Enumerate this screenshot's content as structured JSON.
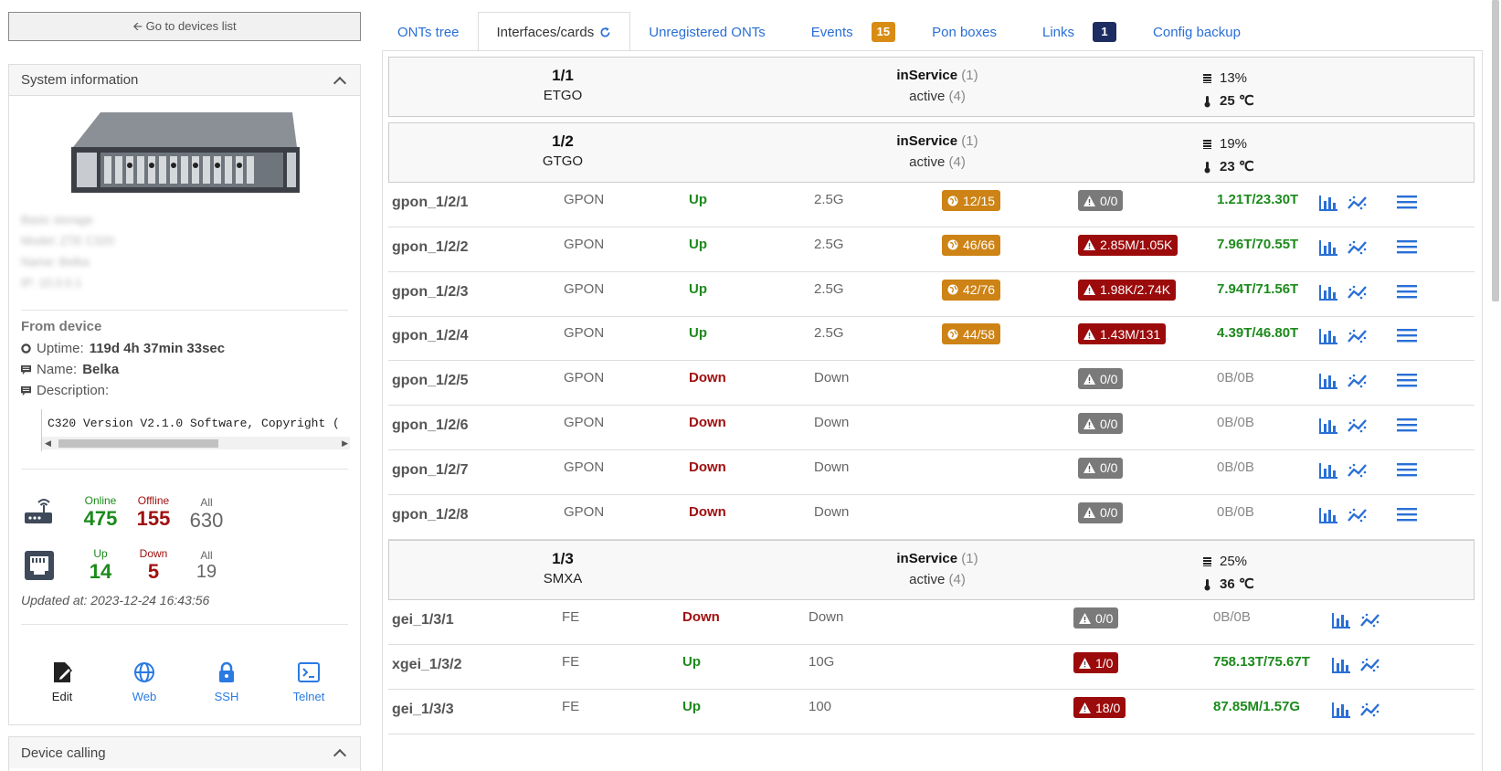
{
  "left": {
    "goback_label": "Go to devices list",
    "sysinfo_title": "System information",
    "blurred_lines": [
      "Basic storage",
      "Model: ZTE C320",
      "Name: Belka",
      "IP: 10.0.0.1"
    ],
    "from_device_label": "From device",
    "uptime_label": "Uptime:",
    "uptime_value": "119d 4h 37min 33sec",
    "name_label": "Name:",
    "name_value": "Belka",
    "description_label": "Description:",
    "description_value": "C320 Version V2.1.0 Software, Copyright (",
    "onts": {
      "online_label": "Online",
      "online": "475",
      "offline_label": "Offline",
      "offline": "155",
      "all_label": "All",
      "all": "630"
    },
    "ports": {
      "up_label": "Up",
      "up": "14",
      "down_label": "Down",
      "down": "5",
      "all_label": "All",
      "all": "19"
    },
    "updated_at": "Updated at: 2023-12-24 16:43:56",
    "actions": [
      "Edit",
      "Web",
      "SSH",
      "Telnet"
    ],
    "device_calling_title": "Device calling"
  },
  "tabs": [
    {
      "label": "ONTs tree"
    },
    {
      "label": "Interfaces/cards",
      "active": true
    },
    {
      "label": "Unregistered ONTs"
    },
    {
      "label": "Events",
      "badge": "15"
    },
    {
      "label": "Pon boxes"
    },
    {
      "label": "Links",
      "badge": "1"
    },
    {
      "label": "Config backup"
    }
  ],
  "cards": [
    {
      "slot": "1/1",
      "type": "ETGO",
      "status": "inService",
      "status_count": "(1)",
      "oper": "active",
      "oper_count": "(4)",
      "cpu": "13%",
      "temp": "25 ℃"
    },
    {
      "slot": "1/2",
      "type": "GTGO",
      "status": "inService",
      "status_count": "(1)",
      "oper": "active",
      "oper_count": "(4)",
      "cpu": "19%",
      "temp": "23 ℃"
    },
    {
      "slot": "1/3",
      "type": "SMXA",
      "status": "inService",
      "status_count": "(1)",
      "oper": "active",
      "oper_count": "(4)",
      "cpu": "25%",
      "temp": "36 ℃"
    }
  ],
  "gpon_rows": [
    {
      "name": "gpon_1/2/1",
      "type": "GPON",
      "state": "Up",
      "speed": "2.5G",
      "onts": "12/15",
      "errors": "0/0",
      "err_level": "grey",
      "traffic": "1.21T/23.30T"
    },
    {
      "name": "gpon_1/2/2",
      "type": "GPON",
      "state": "Up",
      "speed": "2.5G",
      "onts": "46/66",
      "errors": "2.85M/1.05K",
      "err_level": "red",
      "traffic": "7.96T/70.55T"
    },
    {
      "name": "gpon_1/2/3",
      "type": "GPON",
      "state": "Up",
      "speed": "2.5G",
      "onts": "42/76",
      "errors": "1.98K/2.74K",
      "err_level": "red",
      "traffic": "7.94T/71.56T"
    },
    {
      "name": "gpon_1/2/4",
      "type": "GPON",
      "state": "Up",
      "speed": "2.5G",
      "onts": "44/58",
      "errors": "1.43M/131",
      "err_level": "red",
      "traffic": "4.39T/46.80T"
    },
    {
      "name": "gpon_1/2/5",
      "type": "GPON",
      "state": "Down",
      "speed": "Down",
      "onts": "",
      "errors": "0/0",
      "err_level": "grey",
      "traffic": "0B/0B"
    },
    {
      "name": "gpon_1/2/6",
      "type": "GPON",
      "state": "Down",
      "speed": "Down",
      "onts": "",
      "errors": "0/0",
      "err_level": "grey",
      "traffic": "0B/0B"
    },
    {
      "name": "gpon_1/2/7",
      "type": "GPON",
      "state": "Down",
      "speed": "Down",
      "onts": "",
      "errors": "0/0",
      "err_level": "grey",
      "traffic": "0B/0B"
    },
    {
      "name": "gpon_1/2/8",
      "type": "GPON",
      "state": "Down",
      "speed": "Down",
      "onts": "",
      "errors": "0/0",
      "err_level": "grey",
      "traffic": "0B/0B"
    }
  ],
  "eth_rows": [
    {
      "name": "gei_1/3/1",
      "type": "FE",
      "state": "Down",
      "speed": "Down",
      "errors": "0/0",
      "err_level": "grey",
      "traffic": "0B/0B"
    },
    {
      "name": "xgei_1/3/2",
      "type": "FE",
      "state": "Up",
      "speed": "10G",
      "errors": "1/0",
      "err_level": "red",
      "traffic": "758.13T/75.67T"
    },
    {
      "name": "gei_1/3/3",
      "type": "FE",
      "state": "Up",
      "speed": "100",
      "errors": "18/0",
      "err_level": "red",
      "traffic": "87.85M/1.57G"
    }
  ],
  "colors": {
    "link": "#2a6fd6",
    "green": "#1c8a1c",
    "red": "#a01010",
    "orange": "#cd8315",
    "navy": "#1d2d62"
  }
}
